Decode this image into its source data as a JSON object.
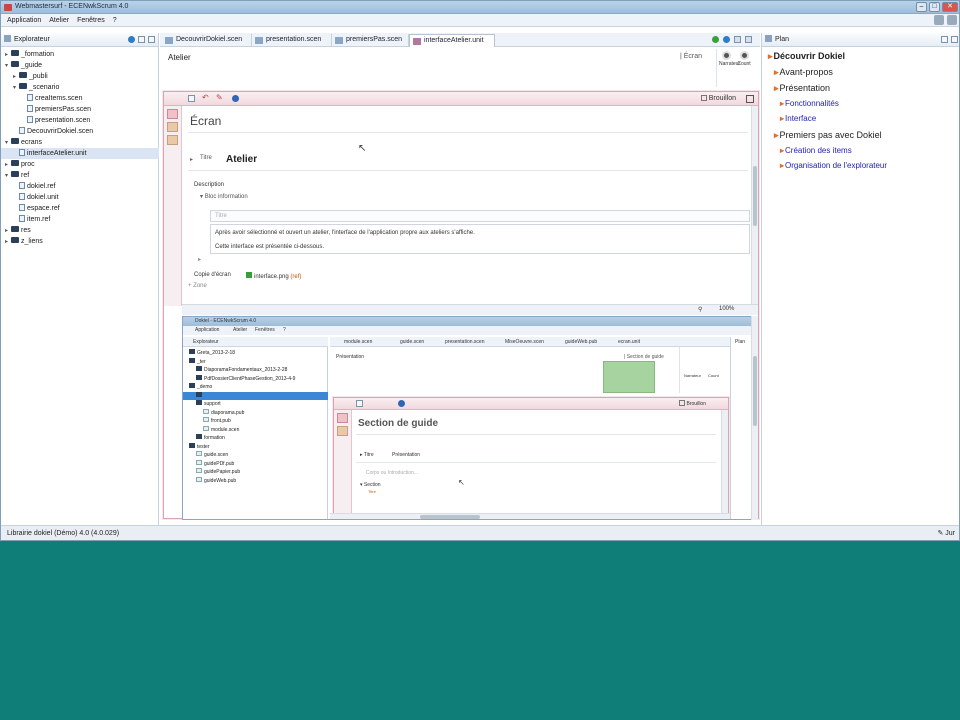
{
  "window": {
    "title": "Webmastersurf - ECENwkScrum 4.0"
  },
  "menubar": {
    "items": [
      "Application",
      "Atelier",
      "Fenêtres",
      "?"
    ]
  },
  "explorer": {
    "title": "Explorateur",
    "tree": [
      {
        "label": "_formation",
        "depth": 0,
        "kind": "folder",
        "tw": "▸"
      },
      {
        "label": "_guide",
        "depth": 0,
        "kind": "folder",
        "tw": "▾"
      },
      {
        "label": "_publi",
        "depth": 1,
        "kind": "folder",
        "tw": "▸"
      },
      {
        "label": "_scenario",
        "depth": 1,
        "kind": "folder",
        "tw": "▾"
      },
      {
        "label": "creaItems.scen",
        "depth": 2,
        "kind": "file",
        "tw": ""
      },
      {
        "label": "premiersPas.scen",
        "depth": 2,
        "kind": "file",
        "tw": ""
      },
      {
        "label": "presentation.scen",
        "depth": 2,
        "kind": "file",
        "tw": ""
      },
      {
        "label": "DecouvrirDokiel.scen",
        "depth": 1,
        "kind": "file",
        "tw": ""
      },
      {
        "label": "ecrans",
        "depth": 0,
        "kind": "folder",
        "tw": "▾"
      },
      {
        "label": "interfaceAtelier.unit",
        "depth": 1,
        "kind": "file",
        "tw": "",
        "selected": true
      },
      {
        "label": "proc",
        "depth": 0,
        "kind": "folder",
        "tw": "▸"
      },
      {
        "label": "ref",
        "depth": 0,
        "kind": "folder",
        "tw": "▾"
      },
      {
        "label": "dokiel.ref",
        "depth": 1,
        "kind": "file",
        "tw": ""
      },
      {
        "label": "dokiel.unit",
        "depth": 1,
        "kind": "file",
        "tw": ""
      },
      {
        "label": "espace.ref",
        "depth": 1,
        "kind": "file",
        "tw": ""
      },
      {
        "label": "item.ref",
        "depth": 1,
        "kind": "file",
        "tw": ""
      },
      {
        "label": "res",
        "depth": 0,
        "kind": "folder",
        "tw": "▸"
      },
      {
        "label": "z_liens",
        "depth": 0,
        "kind": "folder",
        "tw": "▸"
      }
    ]
  },
  "editor_tabs": [
    "DecouvrirDokiel.scen",
    "presentation.scen",
    "premiersPas.scen",
    "interfaceAtelier.unit"
  ],
  "editor": {
    "header_title": "Atelier",
    "header_type": "| Écran",
    "tools": [
      "Narrateur",
      "Count"
    ],
    "window": {
      "brouillon": "Brouillon",
      "heading": "Écran",
      "titre_label": "Titre",
      "titre_value": "Atelier",
      "description_label": "Description",
      "bloc_label": "Bloc information",
      "titre_placeholder": "Titre",
      "para1": "Après avoir sélectionné et ouvert un atelier, l'interface de l'application propre aux ateliers s'affiche.",
      "para2": "Cette interface est présentée ci-dessous.",
      "copie_label": "Copie d'écran",
      "copie_file": "interface.png",
      "copie_ref": "(ref)",
      "zone_label": "Zone",
      "zoom": "100%"
    }
  },
  "inner": {
    "title": "Dokiel - ECENwkScrum 4.0",
    "menubar": [
      "Application",
      "Atelier",
      "Fenêtres",
      "?"
    ],
    "explorer_title": "Explorateur",
    "tree": [
      {
        "label": "Greta_2013-2-18",
        "depth": 0
      },
      {
        "label": "_ter",
        "depth": 0
      },
      {
        "label": "DiaporamaFondamentaux_2013-2-28",
        "depth": 1
      },
      {
        "label": "PdfDossierClientPhaseGestion_2013-4-9",
        "depth": 1
      },
      {
        "label": "_demo",
        "depth": 0
      },
      {
        "label": "",
        "depth": 1,
        "selected": true
      },
      {
        "label": "support",
        "depth": 1
      },
      {
        "label": "diaporama.pub",
        "depth": 2
      },
      {
        "label": "front.pub",
        "depth": 2
      },
      {
        "label": "module.scen",
        "depth": 2
      },
      {
        "label": "formation",
        "depth": 1
      },
      {
        "label": "tester",
        "depth": 0
      },
      {
        "label": "guide.scen",
        "depth": 1
      },
      {
        "label": "guidePDf.pub",
        "depth": 1
      },
      {
        "label": "guidePapier.pub",
        "depth": 1
      },
      {
        "label": "guideWeb.pub",
        "depth": 1
      }
    ],
    "tabs": [
      "module.scen",
      "guide.scen",
      "presentation.scen",
      "MiseOeuvre.scen",
      "guideWeb.pub",
      "ecran.unit"
    ],
    "header_title": "Présentation",
    "header_type": "| Section de guide",
    "tools": [
      "Narrateur",
      "Count"
    ],
    "window": {
      "brouillon": "Brouillon",
      "heading": "Section de guide",
      "titre_label": "Titre",
      "titre_value": "Présentation",
      "intro_placeholder": "Corps ou Introduction...",
      "section_label": "Section",
      "section_sub": "Titre"
    },
    "plan_title": "Plan"
  },
  "plan": {
    "title": "Plan",
    "items": [
      {
        "label": "Découvrir Dokiel",
        "level": 0,
        "bold": true
      },
      {
        "label": "Avant-propos",
        "level": 1
      },
      {
        "label": "Présentation",
        "level": 1
      },
      {
        "label": "Fonctionnalités",
        "level": 2
      },
      {
        "label": "Interface",
        "level": 2
      },
      {
        "label": "Premiers pas avec Dokiel",
        "level": 1
      },
      {
        "label": "Création des items",
        "level": 2
      },
      {
        "label": "Organisation de l'explorateur",
        "level": 2
      }
    ]
  },
  "statusbar": {
    "left": "Librairie dokiel (Démo) 4.0 (4.0.029)",
    "right": "Jur"
  }
}
